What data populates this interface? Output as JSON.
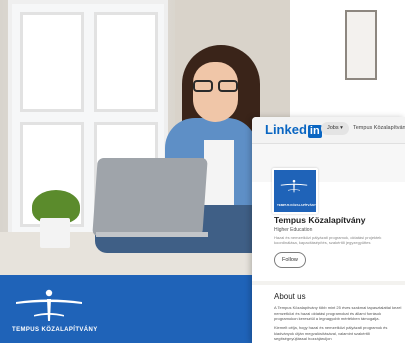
{
  "brand": {
    "logo_text": "TEMPUS KÖZALAPÍTVÁNY",
    "band_color": "#1f63b8"
  },
  "linkedin": {
    "logo_word": "Linked",
    "logo_in": "in",
    "nav_jobs": "Jobs ▾",
    "nav_org": "Tempus Közalapítvány",
    "company_name": "Tempus Közalapítvány",
    "industry": "Higher Education",
    "tagline": "Hazai és nemzetközi pályázati programok, oktatási projektek koordinálása, kapacitásépítés, szakértői jegyzegyüttes",
    "follow_label": "Follow",
    "about_heading": "About us",
    "about_p1": "A Tempus Közalapítvány több mint 25 éves szakmai tapasztalattal kezel nemzetközi és hazai oktatási programokat és állami források programokon keresztül a legnagyobb mértékben támogatja.",
    "about_p2": "Kiemelt célja, hogy hazai és nemzetközi pályázati programok és kiadványok útján megvalósításával, valamint szakértői segítségnyújtással hozzájáruljon",
    "accent": "#0a66c2"
  }
}
